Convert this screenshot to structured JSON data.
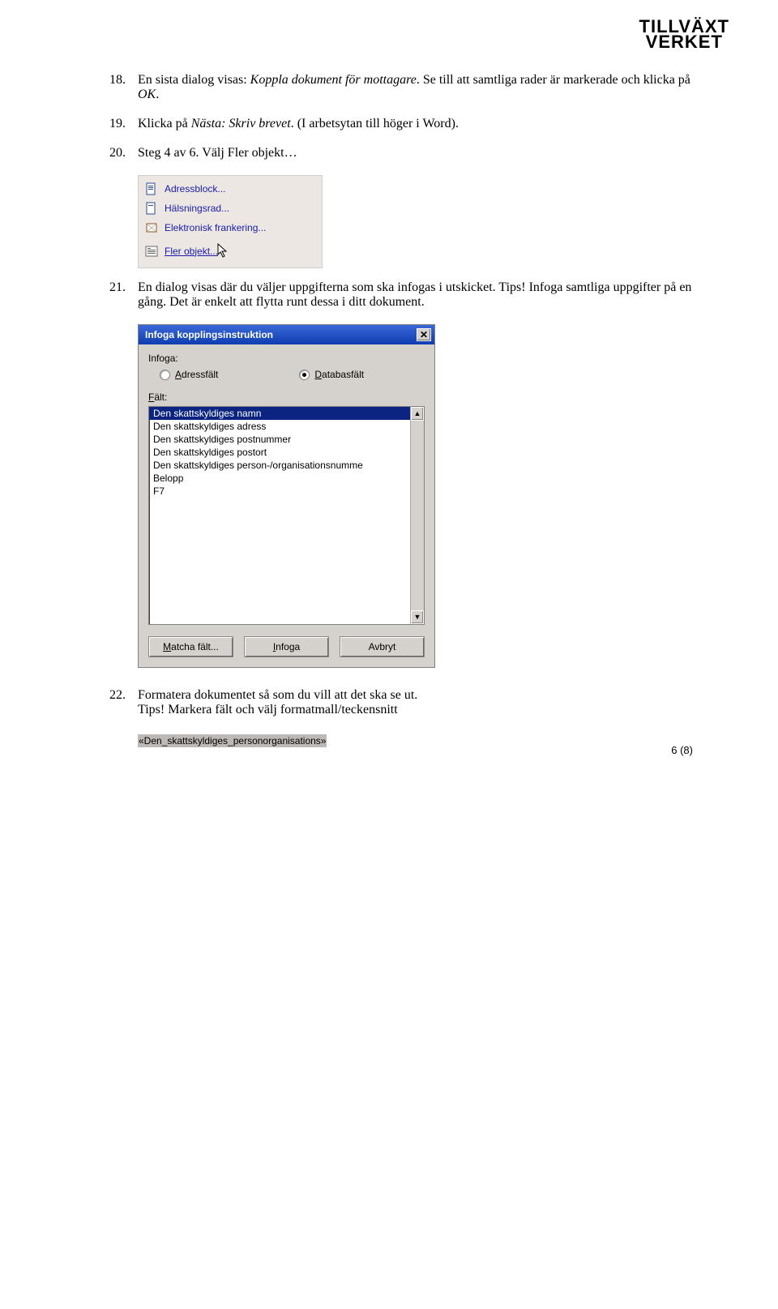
{
  "logo": {
    "line1": "TILLVÄXT",
    "line2": "VERKET"
  },
  "items": {
    "n18": {
      "num": "18.",
      "t1": "En sista dialog visas: ",
      "it": "Koppla dokument för mottagare",
      "t2": ". Se till att samtliga rader är markerade och klicka på ",
      "it2": "OK",
      "t3": "."
    },
    "n19": {
      "num": "19.",
      "t1": "Klicka på ",
      "it": "Nästa: Skriv brevet",
      "t2": ". (I arbetsytan till höger i Word)."
    },
    "n20": {
      "num": "20.",
      "text": "Steg 4 av 6. Välj Fler objekt…"
    },
    "n21": {
      "num": "21.",
      "text": "En dialog visas där du väljer uppgifterna som ska infogas i utskicket. Tips! Infoga samtliga uppgifter på en gång. Det är enkelt att flytta runt dessa i ditt dokument."
    },
    "n22": {
      "num": "22.",
      "t1": "Formatera dokumentet så som du vill att det ska se ut.",
      "t2": "Tips! Markera fält och välj formatmall/teckensnitt"
    }
  },
  "menu": {
    "items": [
      {
        "text": "Adressblock...",
        "underlined": false,
        "iconColor": "#2a4f8c"
      },
      {
        "text": "Hälsningsrad...",
        "underlined": false,
        "iconColor": "#2a4f8c"
      },
      {
        "text": "Elektronisk frankering...",
        "underlined": false,
        "iconColor": "#8a5a2a"
      },
      {
        "text": "Fler objekt...",
        "underlined": true,
        "iconColor": "#5a5a5a"
      }
    ]
  },
  "dialog": {
    "title": "Infoga kopplingsinstruktion",
    "insert_label": "Infoga:",
    "opt1_a": "A",
    "opt1_rest": "dressfält",
    "opt2_a": "D",
    "opt2_rest": "atabasfält",
    "fields_a": "F",
    "fields_rest": "ält:",
    "list": [
      "Den skattskyldiges namn",
      "Den skattskyldiges adress",
      "Den skattskyldiges postnummer",
      "Den skattskyldiges postort",
      "Den skattskyldiges person-/organisationsnumme",
      "Belopp",
      "F7"
    ],
    "btn_match_a": "M",
    "btn_match_rest": "atcha fält...",
    "btn_insert_a": "I",
    "btn_insert_rest": "nfoga",
    "btn_cancel": "Avbryt"
  },
  "field_code": "«Den_skattskyldiges_personorganisations»",
  "footer": "6 (8)"
}
